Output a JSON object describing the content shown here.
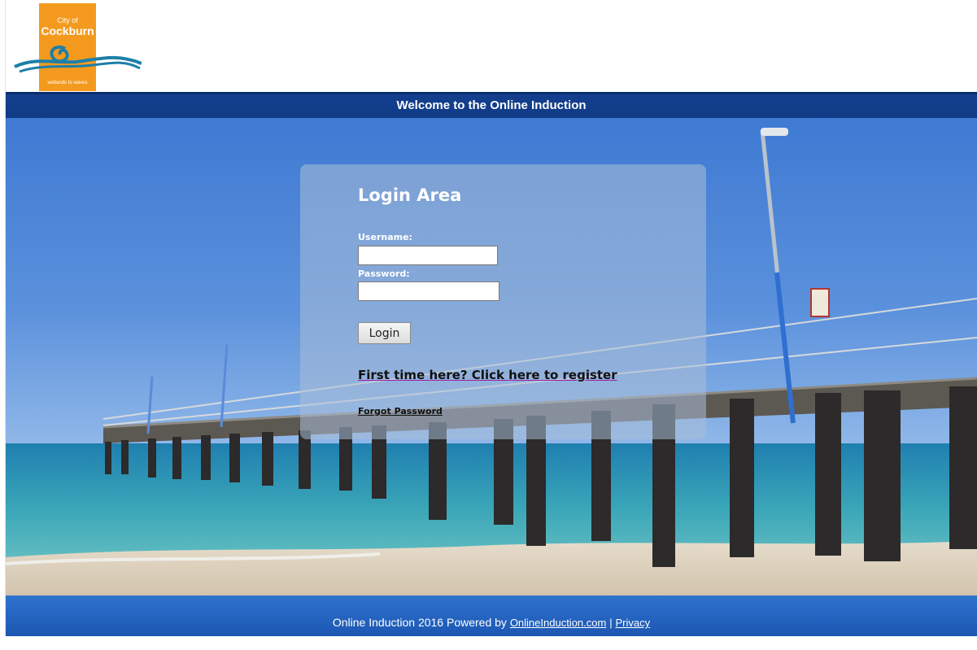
{
  "header": {
    "logo": {
      "city_line": "City of",
      "name_line": "Cockburn",
      "tagline": "wetlands to waves",
      "color": "#f39a1e"
    }
  },
  "welcome_bar": {
    "text": "Welcome to the Online Induction",
    "color": "#143f8e"
  },
  "login": {
    "title": "Login Area",
    "username_label": "Username:",
    "username_value": "",
    "password_label": "Password:",
    "password_value": "",
    "login_button": "Login",
    "register_link": "First time here? Click here to register",
    "forgot_link": "Forgot Password"
  },
  "footer": {
    "text": "Online Induction 2016 Powered by",
    "site_link": "OnlineInduction.com",
    "separator": "|",
    "privacy_link": "Privacy"
  }
}
